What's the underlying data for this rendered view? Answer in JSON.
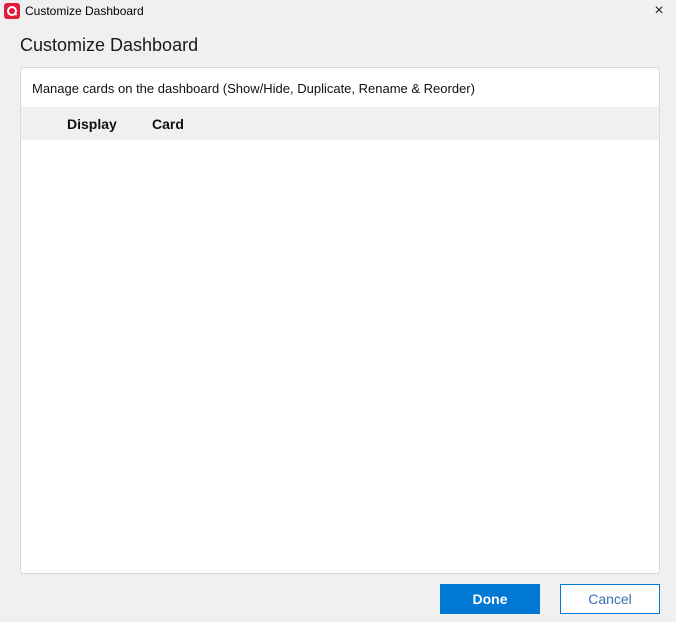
{
  "window": {
    "title": "Customize Dashboard",
    "close_icon": "×"
  },
  "dialog": {
    "heading": "Customize Dashboard",
    "description": "Manage cards on the dashboard (Show/Hide, Duplicate, Rename & Reorder)",
    "columns": [
      "Display",
      "Card"
    ],
    "rows": []
  },
  "buttons": {
    "done": "Done",
    "cancel": "Cancel"
  },
  "colors": {
    "accent": "#0078d4",
    "app_icon": "#e31b3c"
  }
}
